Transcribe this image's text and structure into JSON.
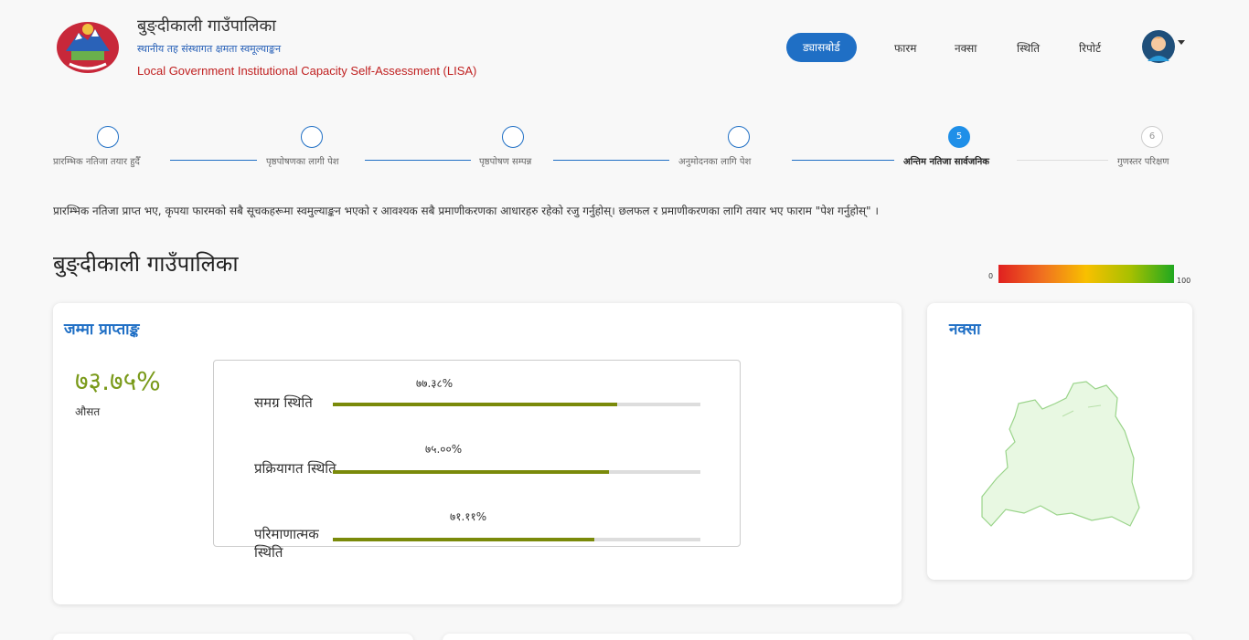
{
  "header": {
    "title": "बुङ्दीकाली गाउँपालिका",
    "subtitle": "स्थानीय तह संस्थागत क्षमता स्वमूल्याङ्कन",
    "subtitle_en": "Local Government Institutional Capacity Self-Assessment (LISA)"
  },
  "nav": {
    "dashboard": "ड्यासबोर्ड",
    "form": "फारम",
    "map": "नक्सा",
    "status": "स्थिति",
    "report": "रिपोर्ट"
  },
  "stepper": {
    "steps": [
      {
        "label": "प्रारम्भिक नतिजा तयार हुदैँ",
        "number": ""
      },
      {
        "label": "पृष्ठपोषणका लागी पेश",
        "number": ""
      },
      {
        "label": "पृष्ठपोषण सम्पन्न",
        "number": ""
      },
      {
        "label": "अनुमोदनका लागि पेश",
        "number": ""
      },
      {
        "label": "अन्तिम नतिजा सार्वजनिक",
        "number": "5"
      },
      {
        "label": "गुणस्तर परिक्षण",
        "number": "6"
      }
    ]
  },
  "instruction": "प्रारम्भिक नतिजा प्राप्त भए, कृपया फारमको सबै सूचकहरूमा स्वमुल्याङ्कन भएको र आवश्यक सबै प्रमाणीकरणका आधारहरु रहेको रजु गर्नुहोस्। छलफल र प्रमाणीकरणका लागि तयार भए फाराम \"पेश गर्नुहोस्\" ।",
  "page_title": "बुङ्दीकाली गाउँपालिका",
  "scale": {
    "min": "0",
    "max": "100"
  },
  "score_card": {
    "title": "जम्मा प्राप्ताङ्क",
    "total": "७३.७५%",
    "total_caption": "औसत",
    "rows": [
      {
        "label": "समग्र स्थिति",
        "value": "७७.३८%",
        "fraction": 0.7738
      },
      {
        "label": "प्रक्रियागत स्थिति",
        "value": "७५.००%",
        "fraction": 0.75
      },
      {
        "label": "परिमाणात्मक स्थिति",
        "value": "७१.११%",
        "fraction": 0.7111
      }
    ]
  },
  "map_card": {
    "title": "नक्सा"
  }
}
